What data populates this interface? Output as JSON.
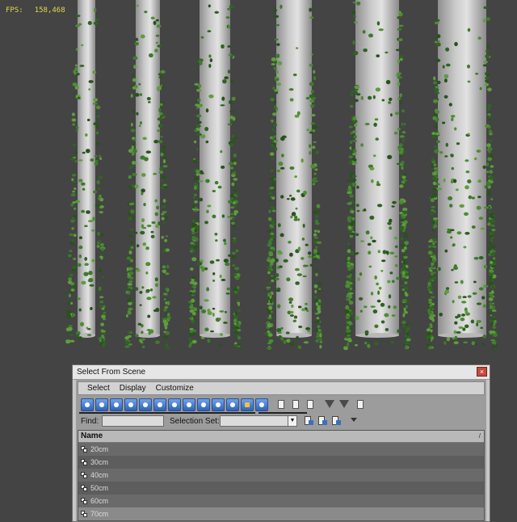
{
  "viewport": {
    "fps_label": "FPS:",
    "fps_value": "158,468",
    "background": "#444444",
    "bark_color": "#c9c9c9",
    "leaf_color": "#3f7a2c"
  },
  "dialog": {
    "title": "Select From Scene",
    "close_label": "×",
    "menu": [
      "Select",
      "Display",
      "Customize"
    ],
    "toolbar_icons": [
      "display-none-icon",
      "display-geometry-icon",
      "display-shapes-icon",
      "display-lights-icon",
      "display-cameras-icon",
      "display-helpers-icon",
      "display-spacewarps-icon",
      "display-groups-icon",
      "display-xrefs-icon",
      "display-bones-icon",
      "display-containers-icon",
      "display-frozen-icon",
      "display-hidden-icon",
      "select-all-icon",
      "select-none-icon",
      "select-invert-icon",
      "filter-icon",
      "filter-options-icon",
      "columns-icon"
    ],
    "find_label": "Find:",
    "find_value": "",
    "selection_set_label": "Selection Set:",
    "selection_set_value": "",
    "list_header": "Name",
    "rows": [
      "20cm",
      "30cm",
      "40cm",
      "50cm",
      "60cm",
      "70cm"
    ],
    "selected_row": "70cm"
  }
}
